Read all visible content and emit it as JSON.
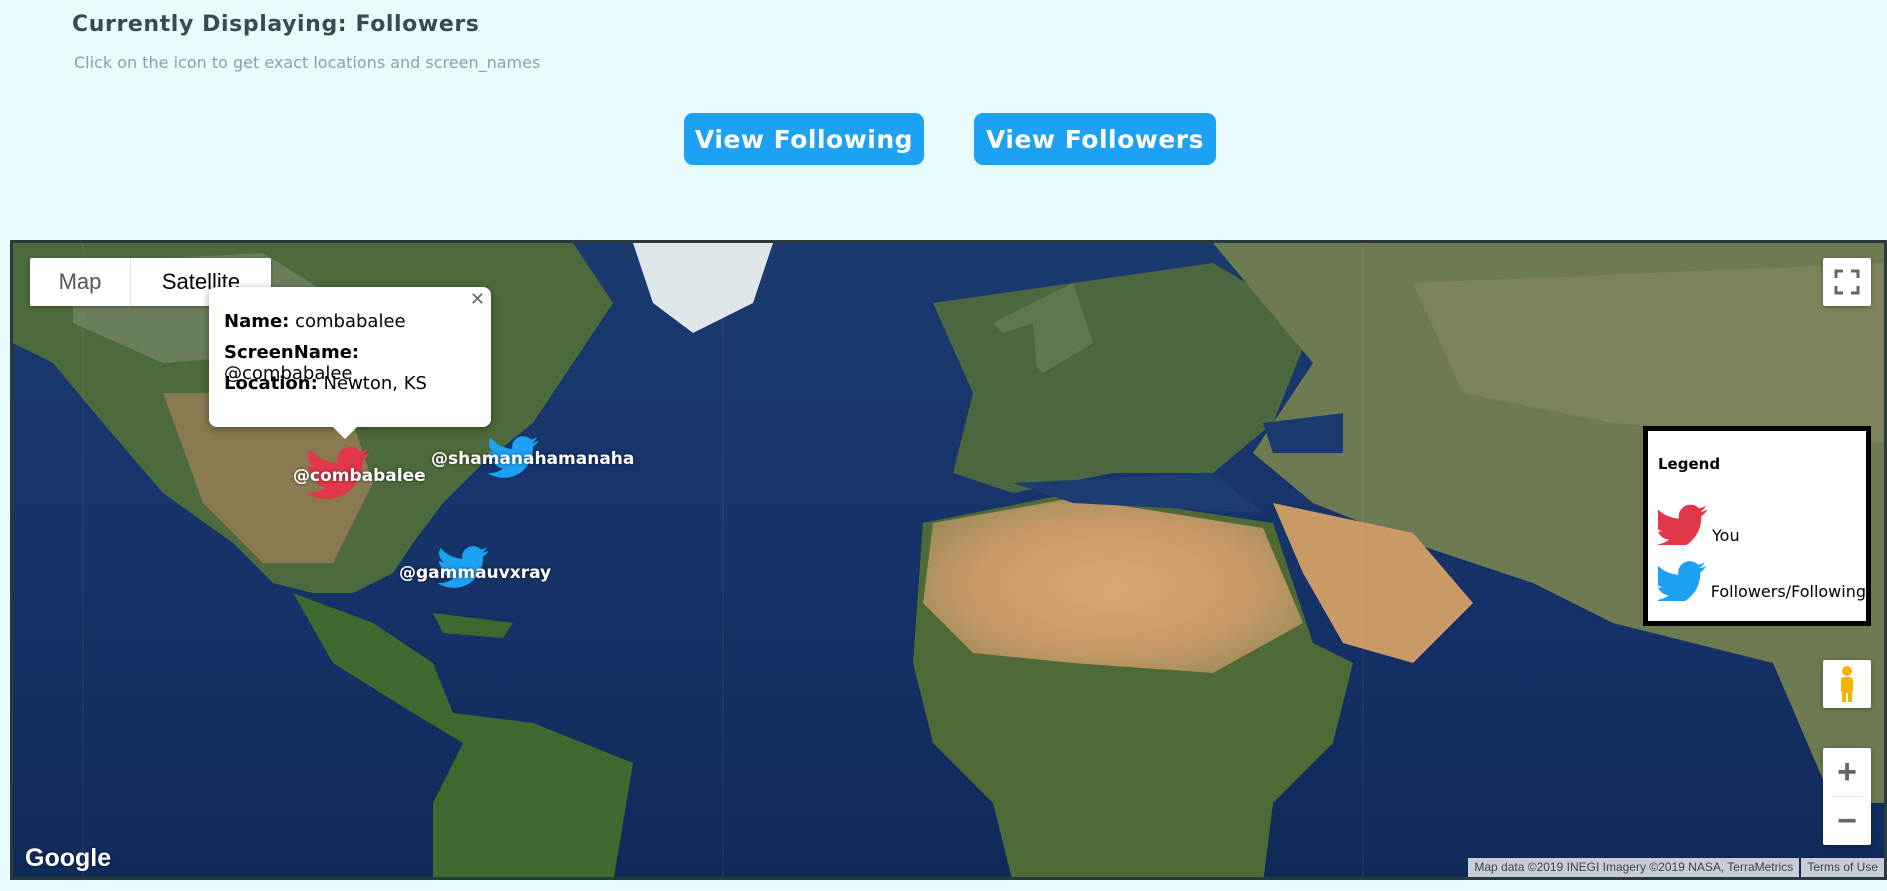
{
  "header": {
    "title": "Currently Displaying: Followers",
    "subtitle": "Click on the icon to get exact locations and screen_names"
  },
  "buttons": {
    "view_following": "View Following",
    "view_followers": "View Followers"
  },
  "map": {
    "type_control": {
      "map_label": "Map",
      "satellite_label": "Satellite",
      "selected": "Satellite"
    },
    "fullscreen_icon": "fullscreen-icon",
    "pegman_icon": "pegman-icon",
    "zoom": {
      "in": "+",
      "out": "−"
    },
    "google_logo": "Google",
    "attribution": {
      "map_data": "Map data ©2019 INEGI Imagery ©2019 NASA, TerraMetrics",
      "terms": "Terms of Use"
    },
    "info_window": {
      "name_label": "Name:",
      "name_value": "combabalee",
      "screen_label": "ScreenName:",
      "screen_value": "@combabalee",
      "location_label": "Location:",
      "location_value": "Newton, KS",
      "close_icon": "close-icon"
    },
    "markers": [
      {
        "label": "@combabalee",
        "role": "you",
        "color": "#e0374a"
      },
      {
        "label": "@shamanahamanaha",
        "role": "follower",
        "color": "#1da1f2"
      },
      {
        "label": "@gammauvxray",
        "role": "follower",
        "color": "#1da1f2"
      }
    ],
    "legend": {
      "title": "Legend",
      "items": [
        {
          "label": "You",
          "icon": "twitter-bird-icon",
          "color": "#e0374a"
        },
        {
          "label": "Followers/Following",
          "icon": "twitter-bird-icon",
          "color": "#1da1f2"
        }
      ]
    }
  },
  "colors": {
    "accent": "#1da1f2",
    "you": "#e0374a",
    "page_bg": "#e8fbfd"
  }
}
